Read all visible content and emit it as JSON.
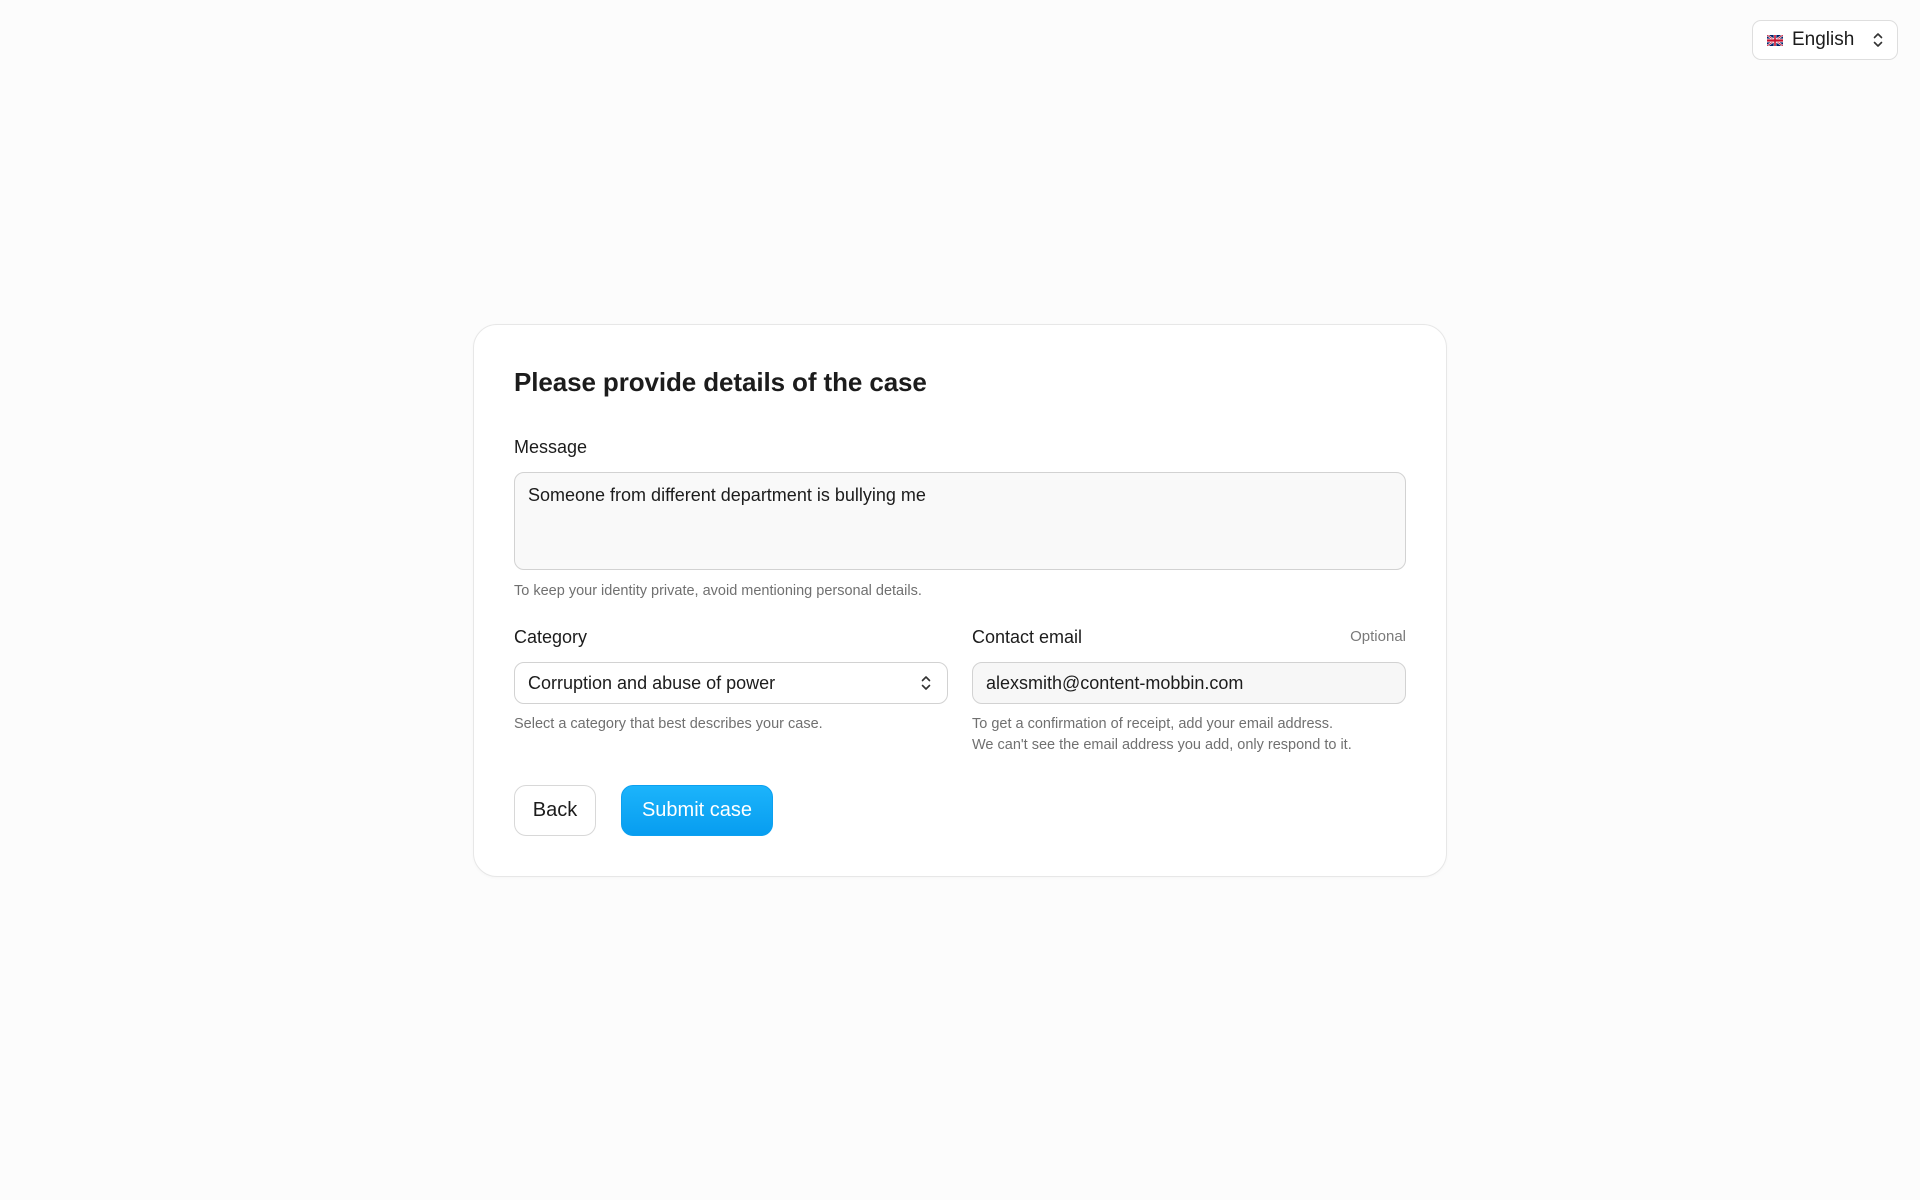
{
  "language_selector": {
    "flag_icon": "uk-flag-icon",
    "label": "English",
    "chevron_icon": "chevron-up-down-icon"
  },
  "form": {
    "title": "Please provide details of the case",
    "message": {
      "label": "Message",
      "value": "Someone from different department is bullying me",
      "help": "To keep your identity private, avoid mentioning personal details."
    },
    "category": {
      "label": "Category",
      "selected": "Corruption and abuse of power",
      "help": "Select a category that best describes your case.",
      "chevron_icon": "chevron-up-down-icon"
    },
    "contact_email": {
      "label": "Contact email",
      "optional_label": "Optional",
      "value": "alexsmith@content-mobbin.com",
      "help_line1": "To get a confirmation of receipt, add your email address.",
      "help_line2": "We can't see the email address you add, only respond to it."
    },
    "buttons": {
      "back_label": "Back",
      "submit_label": "Submit case"
    }
  },
  "colors": {
    "accent": "#079df0",
    "background": "#fcfcfc",
    "card": "#ffffff",
    "help_text": "#707070"
  }
}
